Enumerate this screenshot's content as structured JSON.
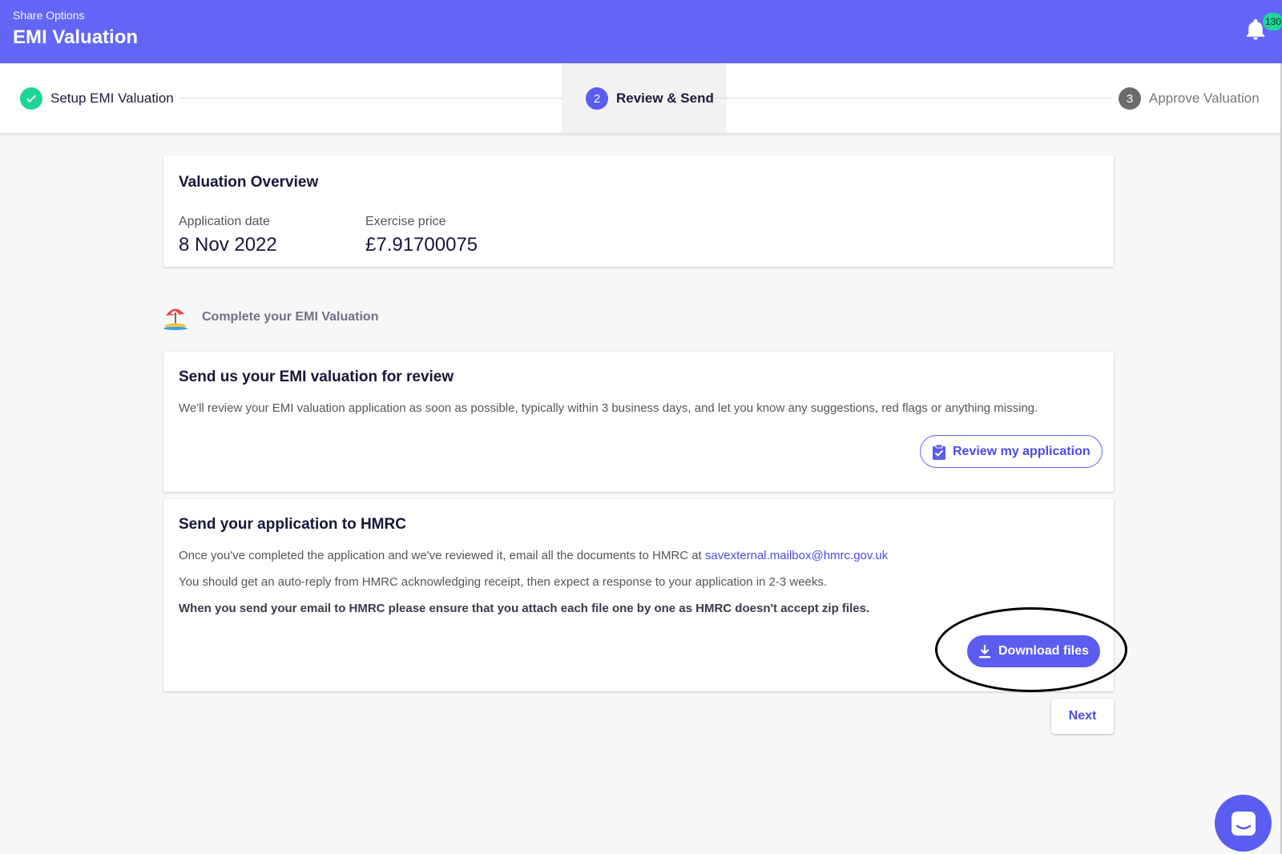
{
  "header": {
    "breadcrumb": "Share Options",
    "title": "EMI Valuation",
    "notification_count": "130"
  },
  "stepper": {
    "steps": [
      {
        "number": "✓",
        "label": "Setup EMI Valuation",
        "state": "complete"
      },
      {
        "number": "2",
        "label": "Review & Send",
        "state": "active"
      },
      {
        "number": "3",
        "label": "Approve Valuation",
        "state": "upcoming"
      }
    ]
  },
  "overview": {
    "title": "Valuation Overview",
    "application_date_label": "Application date",
    "application_date": "8 Nov 2022",
    "exercise_price_label": "Exercise price",
    "exercise_price": "£7.91700075"
  },
  "complete_section": {
    "heading": "Complete your EMI Valuation",
    "icon": "beach-umbrella-icon"
  },
  "review_card": {
    "title": "Send us your EMI valuation for review",
    "body": "We'll review your EMI valuation application as soon as possible, typically within 3 business days, and let you know any suggestions, red flags or anything missing.",
    "button_label": "Review my application"
  },
  "hmrc_card": {
    "title": "Send your application to HMRC",
    "line1_prefix": "Once you've completed the application and we've reviewed it, email all the documents to HMRC at ",
    "email": "savexternal.mailbox@hmrc.gov.uk",
    "line2": "You should get an auto-reply from HMRC acknowledging receipt, then expect a response to your application in 2-3 weeks.",
    "line3": "When you send your email to HMRC please ensure that you attach each file one by one as HMRC doesn't accept zip files.",
    "button_label": "Download files"
  },
  "footer": {
    "next_label": "Next"
  },
  "colors": {
    "brand": "#6366f5",
    "success": "#1fd49a",
    "step_inactive": "#6b6b6b"
  }
}
